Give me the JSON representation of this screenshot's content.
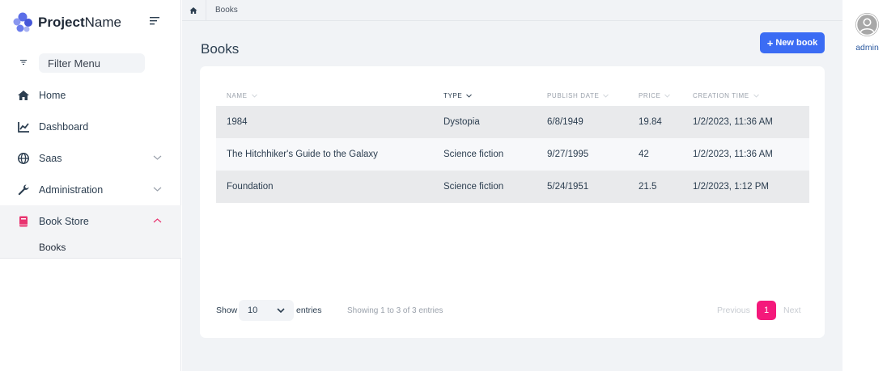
{
  "app": {
    "brand_bold": "Project",
    "brand_light": "Name"
  },
  "sidebar": {
    "filter_placeholder": "Filter Menu",
    "items": [
      {
        "label": "Home",
        "icon": "home-icon"
      },
      {
        "label": "Dashboard",
        "icon": "chart-line-icon"
      },
      {
        "label": "Saas",
        "icon": "globe-icon"
      },
      {
        "label": "Administration",
        "icon": "wrench-icon"
      },
      {
        "label": "Book Store",
        "icon": "book-icon"
      }
    ],
    "subitems": [
      {
        "label": "Books"
      }
    ]
  },
  "breadcrumb": {
    "current": "Books"
  },
  "page": {
    "title": "Books",
    "new_button_label": "New book"
  },
  "table": {
    "columns": [
      "NAME",
      "TYPE",
      "PUBLISH DATE",
      "PRICE",
      "CREATION TIME"
    ],
    "sorted_column": "TYPE",
    "rows": [
      {
        "name": "1984",
        "type": "Dystopia",
        "publish_date": "6/8/1949",
        "price": "19.84",
        "creation_time": "1/2/2023, 11:36 AM"
      },
      {
        "name": "The Hitchhiker's Guide to the Galaxy",
        "type": "Science fiction",
        "publish_date": "9/27/1995",
        "price": "42",
        "creation_time": "1/2/2023, 11:36 AM"
      },
      {
        "name": "Foundation",
        "type": "Science fiction",
        "publish_date": "5/24/1951",
        "price": "21.5",
        "creation_time": "1/2/2023, 1:12 PM"
      }
    ]
  },
  "pagination": {
    "show_label": "Show",
    "page_size": "10",
    "entries_label": "entries",
    "info": "Showing 1 to 3 of 3 entries",
    "previous": "Previous",
    "current_page": "1",
    "next": "Next"
  },
  "user": {
    "name": "admin"
  },
  "colors": {
    "primary": "#3b6cf4",
    "accent_pink": "#f4197b",
    "brand_logo": "#5b6ee8"
  }
}
